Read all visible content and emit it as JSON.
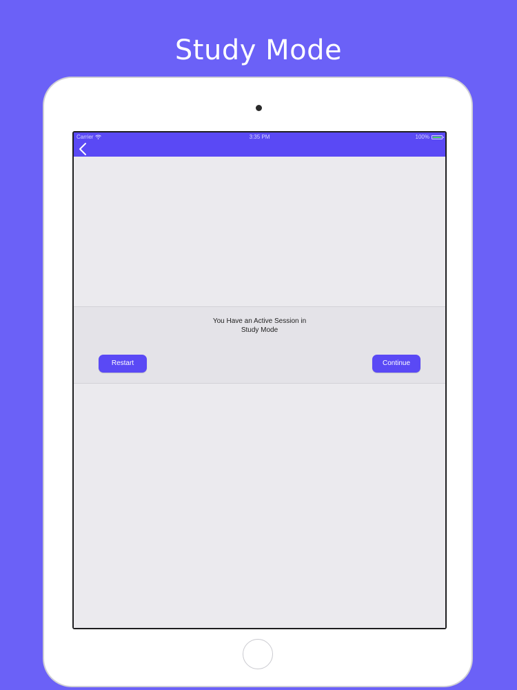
{
  "headline": "Study Mode",
  "colors": {
    "background": "#6b61f7",
    "accent": "#5a49f5",
    "screen_bg": "#ebeaee",
    "dialog_bg": "#e4e3e8"
  },
  "status_bar": {
    "carrier": "Carrier",
    "time": "3:35 PM",
    "battery": "100%",
    "icons": [
      "wifi-icon",
      "battery-icon"
    ]
  },
  "nav": {
    "back_icon": "chevron-left-icon"
  },
  "dialog": {
    "message_line1": "You Have an Active Session in",
    "message_line2": "Study Mode",
    "restart_label": "Restart",
    "continue_label": "Continue"
  }
}
